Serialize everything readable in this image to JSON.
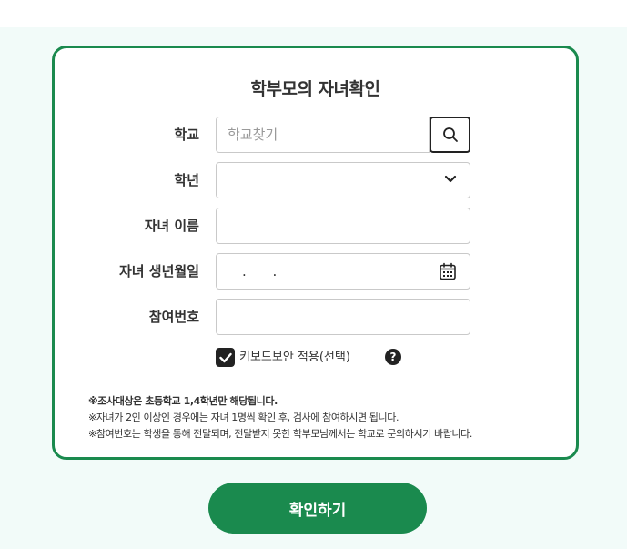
{
  "form": {
    "title": "학부모의 자녀확인",
    "school": {
      "label": "학교",
      "placeholder": "학교찾기",
      "value": ""
    },
    "grade": {
      "label": "학년",
      "selected": ""
    },
    "child_name": {
      "label": "자녀 이름",
      "value": ""
    },
    "birthdate": {
      "label": "자녀 생년월일",
      "value": ". ."
    },
    "participation_number": {
      "label": "참여번호",
      "value": ""
    },
    "keyboard_security": {
      "label": "키보드보안 적용(선택)",
      "checked": true,
      "help": "?"
    }
  },
  "notes": [
    "※조사대상은 초등학교 1,4학년만 해당됩니다.",
    "※자녀가 2인 이상인 경우에는 자녀 1명씩 확인 후, 검사에 참여하시면 됩니다.",
    "※참여번호는 학생을 통해 전달되며, 전달받지 못한 학부모님께서는 학교로 문의하시기 바랍니다."
  ],
  "confirm_button": "확인하기",
  "colors": {
    "accent": "#1a8a4e",
    "background": "#f2fbf9",
    "dark": "#222222"
  },
  "icons": {
    "search": "search-icon",
    "dropdown": "chevron-down-icon",
    "calendar": "calendar-icon",
    "check": "check-icon",
    "help": "help-icon"
  }
}
